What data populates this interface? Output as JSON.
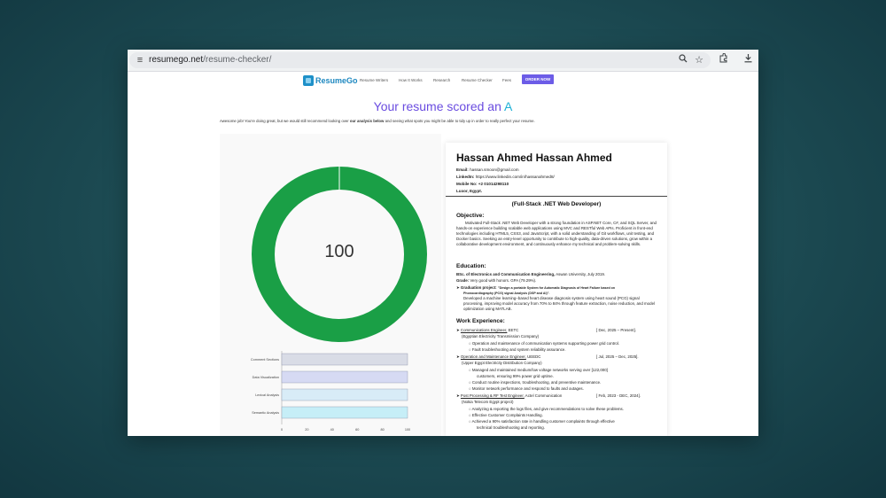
{
  "browser": {
    "url_host": "resumego.net",
    "url_path": "/resume-checker/"
  },
  "site": {
    "logo_text": "ResumeGo",
    "nav": [
      "Resume Writers",
      "How It Works",
      "Research",
      "Resume Checker",
      "Fees"
    ],
    "order_button": "ORDER NOW"
  },
  "page": {
    "title_prefix": "Your resume scored an",
    "grade": "A",
    "intro_before": "Awesome job! You're doing great, but we would still recommend looking over ",
    "intro_bold": "our analysis below",
    "intro_after": " and seeing what spots you might be able to tidy up in order to really perfect your resume."
  },
  "colors": {
    "donut": "#1a9f46",
    "title": "#6a4ce0",
    "grade": "#1eb0d6",
    "order_button": "#6c5ce7"
  },
  "chart_data": [
    {
      "type": "pie",
      "subtype": "donut",
      "values": [
        100
      ],
      "center_label": "100"
    },
    {
      "type": "bar",
      "orientation": "horizontal",
      "categories": [
        "Comment Sections",
        "Data Visualization",
        "Lexical Analysis",
        "Semantic Analysis"
      ],
      "values": [
        100,
        100,
        100,
        100
      ],
      "xticks": [
        "0",
        "20",
        "40",
        "60",
        "80",
        "100"
      ],
      "xlim": [
        0,
        100
      ],
      "colors": [
        "#d9dce6",
        "#d6daf3",
        "#d8ecf7",
        "#c6eef7"
      ]
    }
  ],
  "resume": {
    "name": "Hassan Ahmed Hassan Ahmed",
    "email_label": "Email:",
    "email": "hassan.smoon@gmail.com",
    "linkedin_label": "LinkedIn:",
    "linkedin": "https://www.linkedin.com/in/hassanahmed8/",
    "mobile_label": "Mobile No:",
    "mobile": "+2 01014298110",
    "location": "Luxor, Egypt.",
    "role": "(Full-Stack .NET Web Developer)",
    "objective_heading": "Objective:",
    "objective_text": "Motivated Full-Stack .NET Web Developer with a strong foundation in ASP.NET Core, C#, and SQL Server, and hands-on experience building scalable web applications using MVC and RESTful Web APIs. Proficient in front-end technologies including HTML5, CSS3, and JavaScript, with a solid understanding of Git workflows, unit testing, and Docker basics. Seeking an entry-level opportunity to contribute to high-quality, data-driven solutions, grow within a collaborative development environment, and continuously enhance my technical and problem-solving skills.",
    "education_heading": "Education:",
    "degree": "BSc. of Electronics and Communication Engineering,",
    "degree_rest": " Aswan University, July 2019.",
    "grade_label": "Grade:",
    "grade_value": " Very good with honors. GPA (79.29%).",
    "grad_project_label": "Graduation project:",
    "grad_project_title": "\"Design a portable System for Automatic Diagnosis of Heart Failure based on",
    "grad_project_title2": "Phonocardiography (PCG) signal Analysis (DSP and AI)\".",
    "grad_project_desc": "Developed a machine learning–based heart disease diagnosis system using heart sound (PCG) signal processing, improving model accuracy from 70% to 84% through feature extraction, noise reduction, and model optimization using MATLAB.",
    "work_heading": "Work Experience:",
    "jobs": [
      {
        "title": "Communications Engineer,",
        "company": " EETC",
        "date": "[ Dec, 2025 – Present].",
        "org": "(Egyptian Electricity Transmission Company)",
        "bullets": [
          "Operation and maintenance of communication systems supporting power grid control.",
          "Fault troubleshooting and system reliability assurance."
        ]
      },
      {
        "title": "Operation and Maintenance Engineer,",
        "company": " UEEDC",
        "date": "[ Jul, 2025 – Dec, 2025].",
        "org": "(Upper Egypt Electricity Distribution Company)",
        "bullets": [
          "Managed and maintained medium/low voltage networks serving over [122,000]",
          "customers, ensuring 99% power grid uptime.",
          "Conduct routine inspections, troubleshooting, and preventive maintenance.",
          "Monitor network performance and respond to faults and outages."
        ]
      },
      {
        "title": "Post Processing & RF Test Engineer,",
        "company": " Actel Communication",
        "date": "[ Feb, 2023 - DEC, 2024].",
        "org": "(Nokia Telecom Egypt project)",
        "bullets": [
          "Analyzing & reporting the logs files, and give recommendations to solve these problems.",
          "Effective Customer Complaints Handling.",
          "Achieved a 90% satisfaction rate in handling customer complaints through effective",
          "technical troubleshooting and reporting."
        ]
      }
    ]
  }
}
